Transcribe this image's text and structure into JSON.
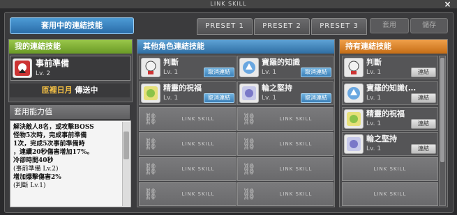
{
  "window": {
    "title": "LINK SKILL",
    "close_icon": "×"
  },
  "tabs": {
    "active": "套用中的連結技能",
    "presets": [
      "PRESET 1",
      "PRESET 2",
      "PRESET 3"
    ],
    "apply": "套用",
    "save": "儲存"
  },
  "my_link": {
    "header": "我的連結技能",
    "skill_name": "事前準備",
    "skill_level": "Lv. 2",
    "transfer_prefix": "匝裡日月",
    "transfer_suffix": "傳送中"
  },
  "ability": {
    "header": "套用能力值",
    "lines": [
      "解決敵人8名，或攻擊BOSS",
      "怪物5次時，完成事前準備",
      "1次，完成5次事前準備時",
      "，連續20秒傷害增加17%。",
      "冷卻時間40秒",
      "(事前準備 Lv.2)",
      "增加爆擊傷害2%",
      "(判斷 Lv.1)"
    ]
  },
  "other_links": {
    "header": "其他角色連結技能",
    "slots": [
      {
        "name": "判斷",
        "level": "Lv. 1",
        "action": "取消連結",
        "icon": "judgement-icon"
      },
      {
        "name": "寶羅的知識",
        "level": "Lv. 1",
        "action": "取消連結",
        "icon": "knowledge-icon"
      },
      {
        "name": "精靈的祝福",
        "level": "Lv. 1",
        "action": "取消連結",
        "icon": "spirit-blessing-icon"
      },
      {
        "name": "輪之堅持",
        "level": "Lv. 1",
        "action": "取消連結",
        "icon": "persistence-icon"
      }
    ],
    "empty_label": "LINK SKILL"
  },
  "owned_links": {
    "header": "持有連結技能",
    "slots": [
      {
        "name": "判斷",
        "level": "Lv. 1",
        "action": "連結",
        "icon": "judgement-icon"
      },
      {
        "name": "寶羅的知識(…",
        "level": "Lv. 1",
        "action": "連結",
        "icon": "knowledge-icon"
      },
      {
        "name": "精靈的祝福",
        "level": "Lv. 1",
        "action": "連結",
        "icon": "spirit-blessing-icon"
      },
      {
        "name": "輪之堅持",
        "level": "Lv. 1",
        "action": "連結",
        "icon": "persistence-icon"
      }
    ],
    "empty_label": "LINK SKILL"
  },
  "colors": {
    "active_tab": "#3a86c4",
    "my_header": "#7aae34",
    "other_header": "#4a8cc4",
    "owned_header": "#de8a2e",
    "transfer_highlight": "#f6c245"
  }
}
